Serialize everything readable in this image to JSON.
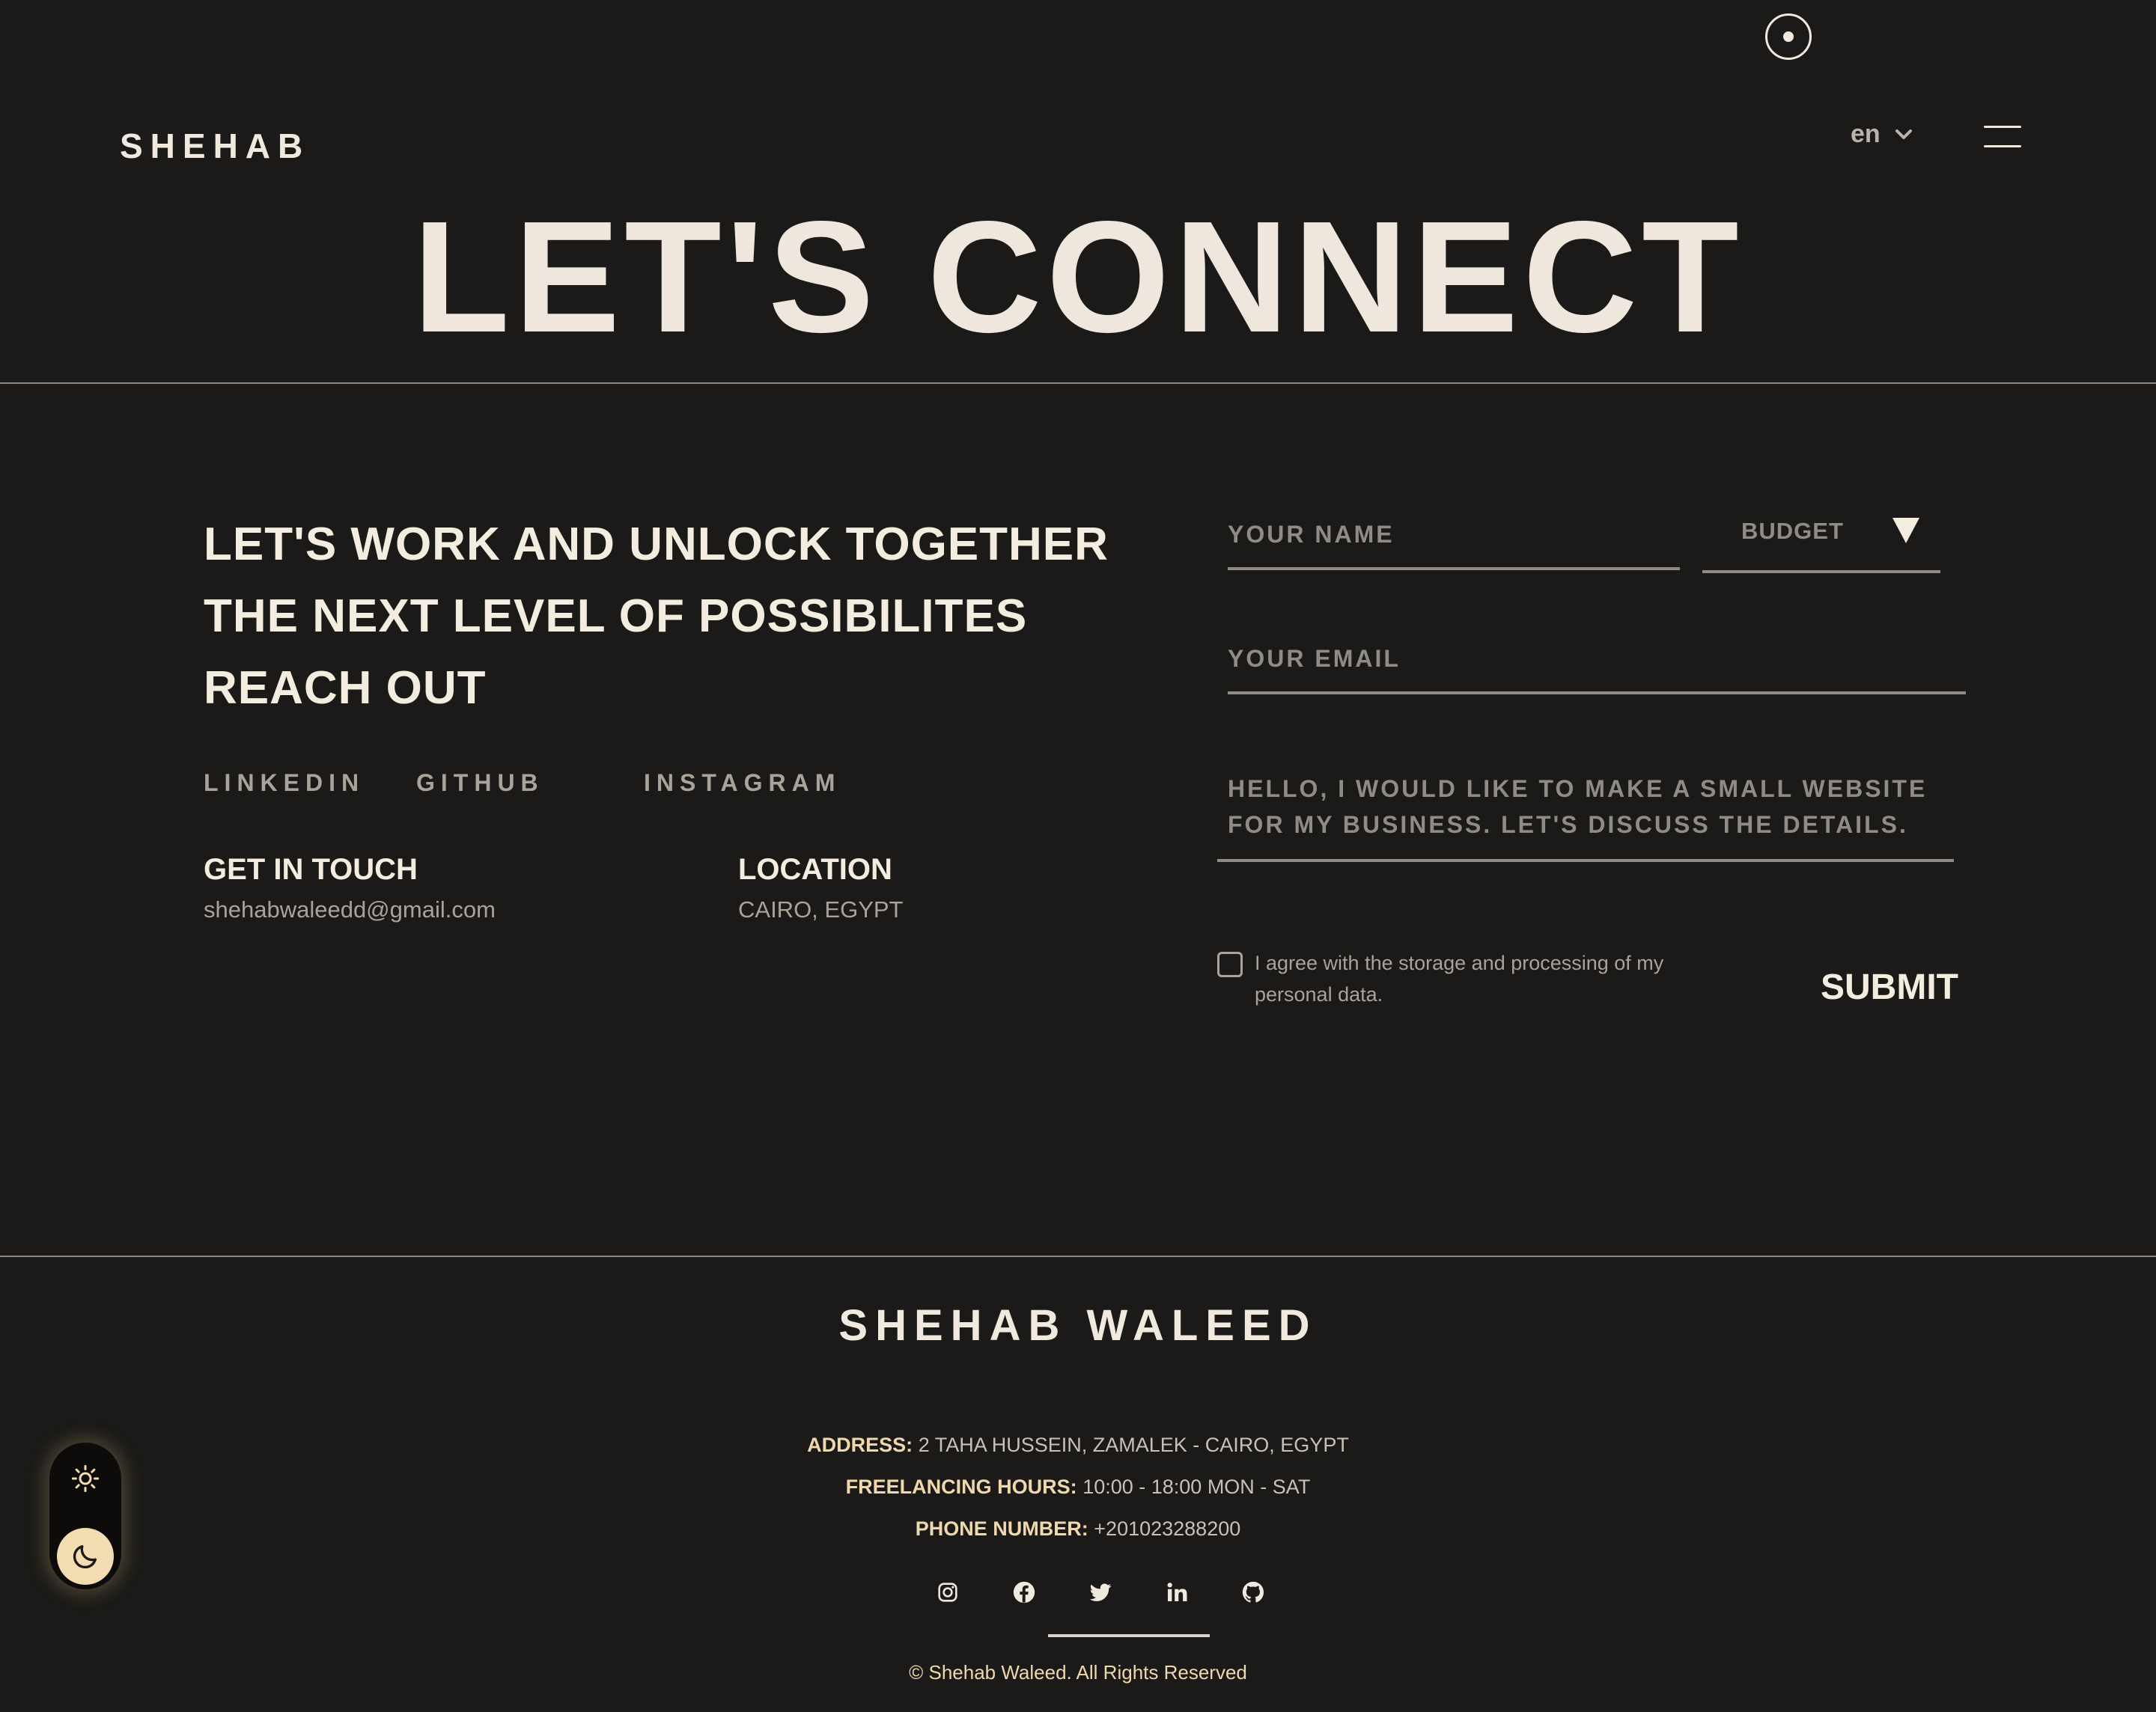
{
  "header": {
    "logo": "SHEHAB",
    "language": "en"
  },
  "hero": {
    "title": "LET'S CONNECT"
  },
  "intro": {
    "line1": "LET'S WORK AND UNLOCK TOGETHER",
    "line2": "THE NEXT LEVEL OF POSSIBILITES",
    "line3": "REACH OUT"
  },
  "social_links": {
    "linkedin": "LINKEDIN",
    "github": "GITHUB",
    "instagram": "INSTAGRAM"
  },
  "contact": {
    "get_in_touch_title": "GET IN TOUCH",
    "email": "shehabwaleedd@gmail.com",
    "location_title": "LOCATION",
    "location": "CAIRO, EGYPT"
  },
  "form": {
    "name_placeholder": "YOUR NAME",
    "budget_label": "BUDGET",
    "email_placeholder": "YOUR EMAIL",
    "message_placeholder": "HELLO, I WOULD LIKE TO MAKE A SMALL WEBSITE FOR MY BUSINESS. LET'S DISCUSS THE DETAILS.",
    "consent": "I agree with the storage and processing of my personal data.",
    "consent_checked": false,
    "submit_label": "SUBMIT"
  },
  "footer": {
    "name": "SHEHAB WALEED",
    "address_label": "ADDRESS:",
    "address": "2 TAHA HUSSEIN, ZAMALEK - CAIRO, EGYPT",
    "hours_label": "FREELANCING HOURS:",
    "hours": "10:00 - 18:00 MON - SAT",
    "phone_label": "PHONE NUMBER:",
    "phone": "+201023288200",
    "icons": [
      "instagram-icon",
      "facebook-icon",
      "twitter-icon",
      "linkedin-icon",
      "github-icon"
    ],
    "copyright": "© Shehab Waleed. All Rights Reserved"
  },
  "theme_toggle": {
    "mode": "dark"
  },
  "colors": {
    "background": "#1b1a18",
    "text": "#f1e9de",
    "muted": "#8f8c86",
    "accent": "#f0d8ad"
  }
}
